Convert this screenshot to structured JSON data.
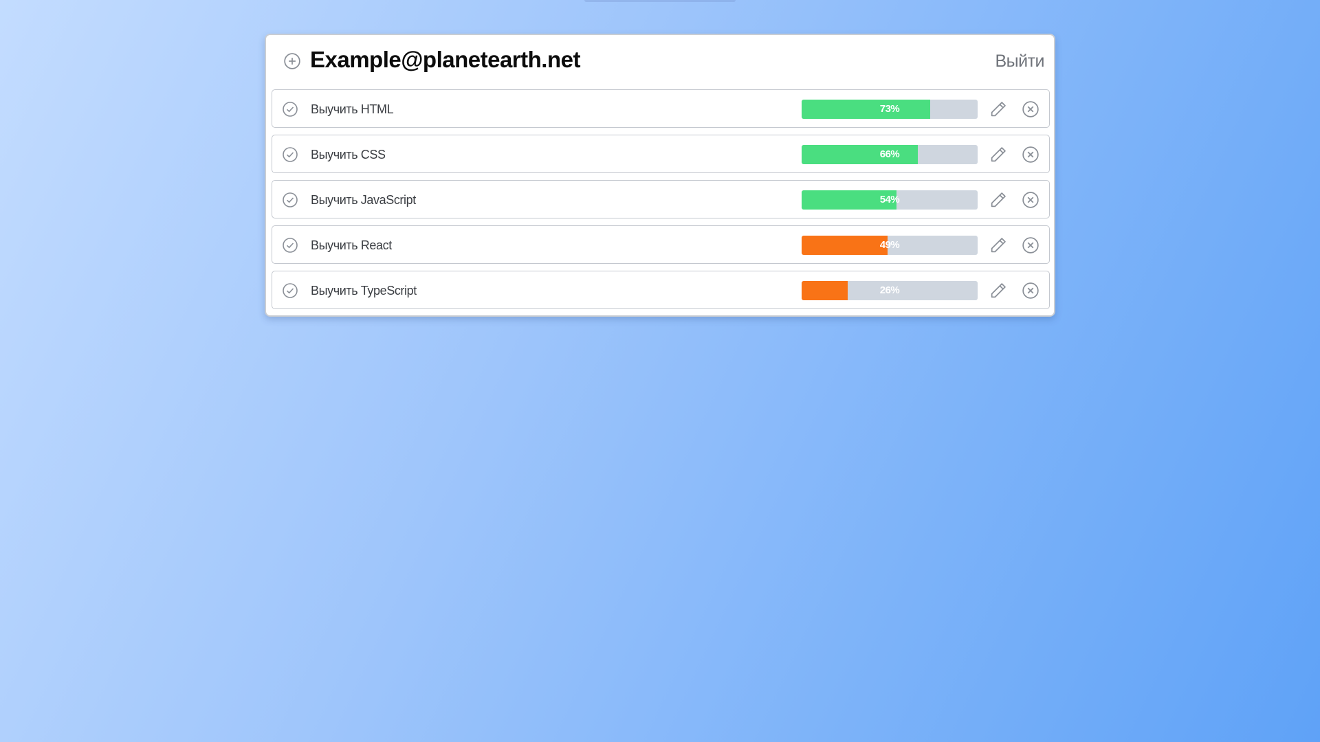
{
  "header": {
    "email": "Example@planetearth.net",
    "logout_label": "Выйти"
  },
  "colors": {
    "high_progress": "#4ade80",
    "low_progress": "#f97316",
    "track": "#cfd6df",
    "icon": "#8a8f97"
  },
  "icons": {
    "add": "plus-circle-icon",
    "complete": "check-circle-icon",
    "edit": "pencil-icon",
    "delete": "x-circle-icon"
  },
  "tasks": [
    {
      "label": "Выучить HTML",
      "progress": 73,
      "progress_text": "73%",
      "color": "#4ade80"
    },
    {
      "label": "Выучить CSS",
      "progress": 66,
      "progress_text": "66%",
      "color": "#4ade80"
    },
    {
      "label": "Выучить JavaScript",
      "progress": 54,
      "progress_text": "54%",
      "color": "#4ade80"
    },
    {
      "label": "Выучить React",
      "progress": 49,
      "progress_text": "49%",
      "color": "#f97316"
    },
    {
      "label": "Выучить TypeScript",
      "progress": 26,
      "progress_text": "26%",
      "color": "#f97316"
    }
  ]
}
